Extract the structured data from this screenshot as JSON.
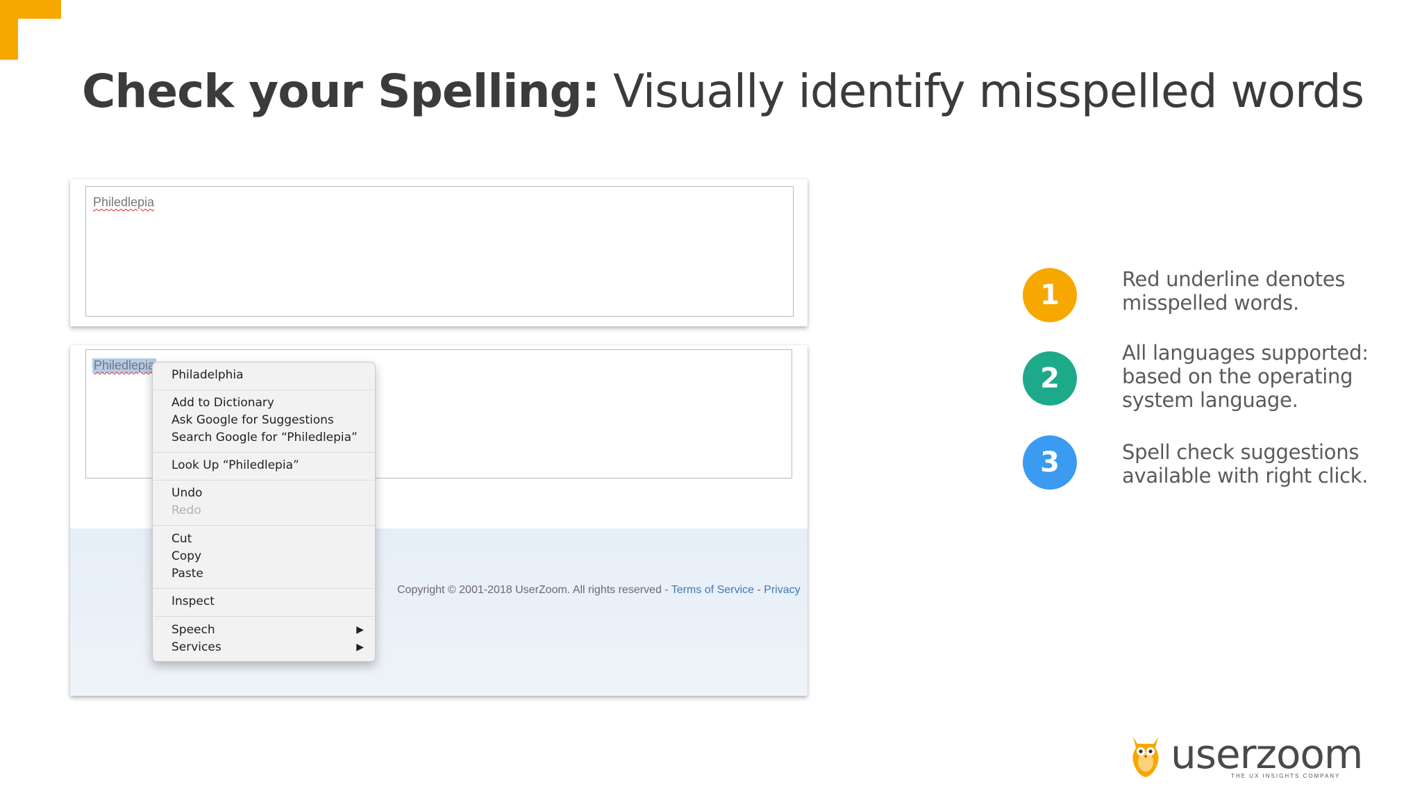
{
  "slide": {
    "title_bold": "Check your Spelling:",
    "title_rest": "Visually identify misspelled words"
  },
  "example1": {
    "typed": "Philedlepia"
  },
  "example2": {
    "typed": "Philedlepia",
    "copyright": "Copyright © 2001-2018 UserZoom. All rights reserved - ",
    "terms_link": "Terms of Service",
    "separator": " - ",
    "privacy_link": "Privacy"
  },
  "context_menu": {
    "suggestion": "Philadelphia",
    "add_to_dictionary": "Add to Dictionary",
    "ask_google": "Ask Google for Suggestions",
    "search_google": "Search Google for “Philedlepia”",
    "look_up": "Look Up “Philedlepia”",
    "undo": "Undo",
    "redo": "Redo",
    "cut": "Cut",
    "copy": "Copy",
    "paste": "Paste",
    "inspect": "Inspect",
    "speech": "Speech",
    "services": "Services",
    "submenu_arrow": "▶"
  },
  "points": [
    {
      "number": "1",
      "color": "#F6A800",
      "text": "Red underline denotes misspelled words."
    },
    {
      "number": "2",
      "color": "#1DAA8A",
      "text": "All languages supported: based on the operating system language."
    },
    {
      "number": "3",
      "color": "#3A9BF0",
      "text": "Spell check suggestions available with right click."
    }
  ],
  "brand": {
    "name": "userzoom",
    "tagline": "THE UX INSIGHTS COMPANY",
    "accent": "#F6A800",
    "icon": "owl-icon"
  }
}
